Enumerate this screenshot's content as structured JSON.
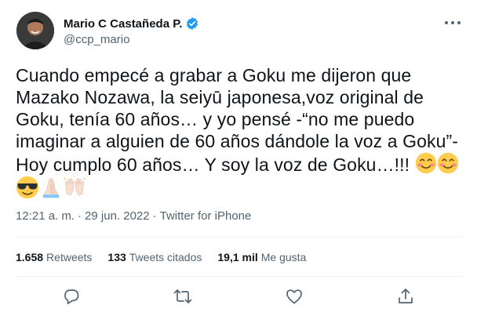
{
  "author": {
    "display_name": "Mario C Castañeda P.",
    "handle": "@ccp_mario",
    "verified": true
  },
  "tweet": {
    "text": "Cuando empecé a grabar a Goku me dijeron que Mazako Nozawa, la seiyū japonesa,voz original de Goku, tenía 60 años… y yo pensé -“no me puedo imaginar a alguien de 60 años dándole la voz a Goku”- Hoy cumplo 60 años… Y soy la voz de Goku…!!!",
    "emojis": [
      "smiling-face-icon",
      "smiling-face-icon",
      "sunglasses-face-icon",
      "folded-hands-icon",
      "raised-hands-icon"
    ]
  },
  "meta": {
    "time": "12:21 a. m.",
    "separator": "·",
    "date": "29 jun. 2022",
    "source": "Twitter for iPhone"
  },
  "stats": {
    "retweets_count": "1.658",
    "retweets_label": "Retweets",
    "quotes_count": "133",
    "quotes_label": "Tweets citados",
    "likes_count": "19,1 mil",
    "likes_label": "Me gusta"
  },
  "colors": {
    "text": "#0f1419",
    "secondary": "#536471",
    "divider": "#eff3f4",
    "verified": "#1d9bf0"
  }
}
